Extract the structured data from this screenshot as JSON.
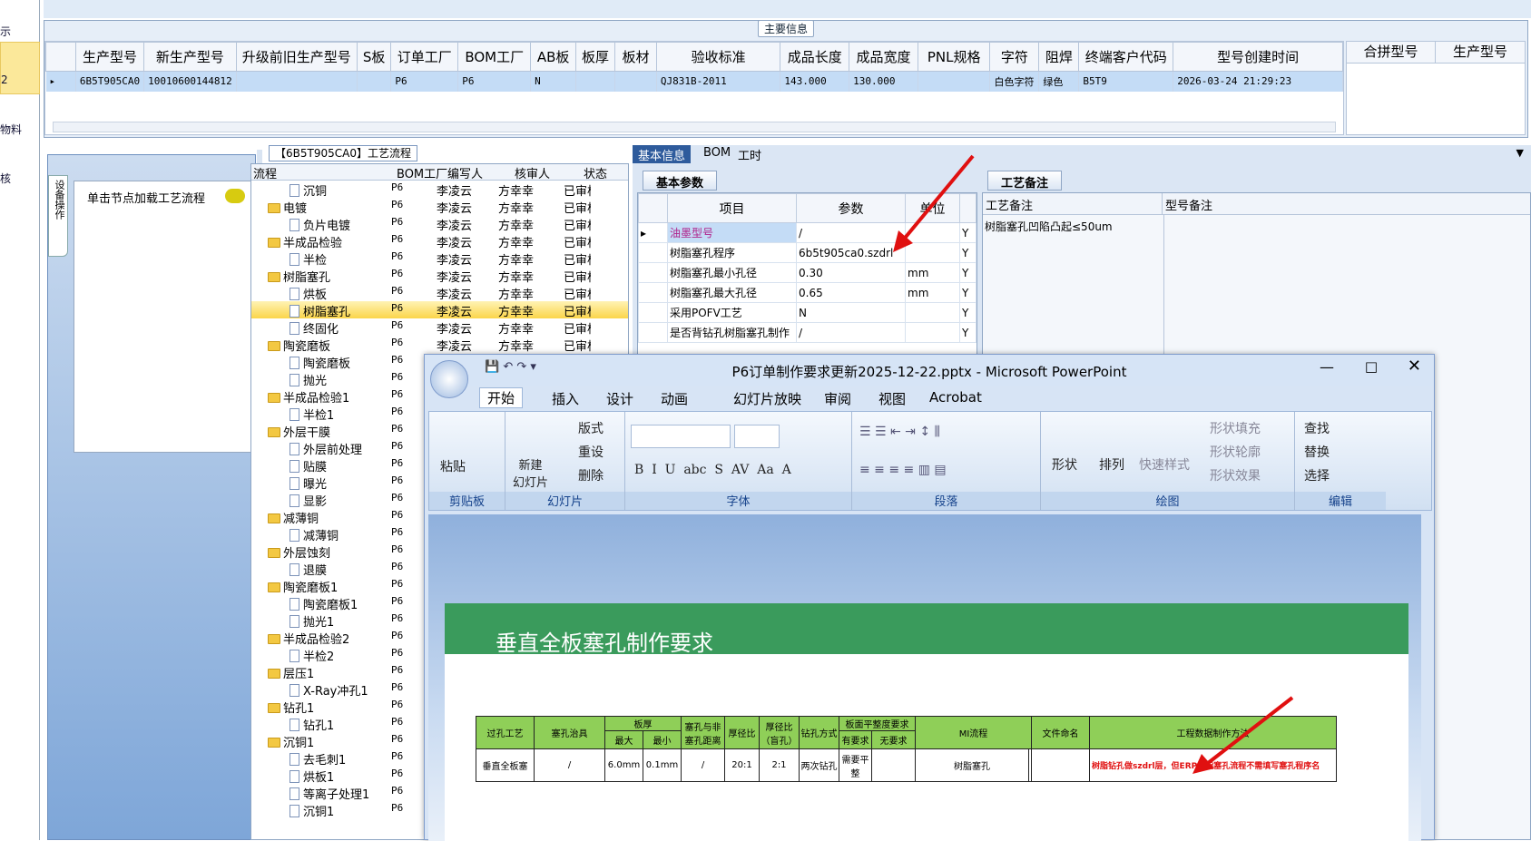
{
  "left_panel": {
    "items": [
      "示",
      "2",
      "物料",
      "核"
    ]
  },
  "main_info": {
    "group_title": "主要信息",
    "columns": [
      "生产型号",
      "新生产型号",
      "升级前旧生产型号",
      "S板",
      "订单工厂",
      "BOM工厂",
      "AB板",
      "板厚",
      "板材",
      "验收标准",
      "成品长度",
      "成品宽度",
      "PNL规格",
      "字符",
      "阻焊",
      "终端客户代码",
      "型号创建时间"
    ],
    "row": [
      "6B5T905CA0",
      "10010600144812",
      "",
      "",
      "P6",
      "P6",
      "N",
      "",
      "",
      "QJ831B-2011",
      "143.000",
      "130.000",
      "",
      "白色字符",
      "绿色",
      "B5T9",
      "2026-03-24 21:29:23"
    ],
    "right_columns": [
      "合拼型号",
      "生产型号"
    ]
  },
  "sidebar": {
    "vtab": "设备操作",
    "hint": "单击节点加载工艺流程"
  },
  "flow": {
    "title": "【6B5T905CA0】工艺流程",
    "columns": [
      "流程",
      "BOM工厂",
      "编写人",
      "核审人",
      "状态"
    ],
    "rows": [
      {
        "n": "沉铜",
        "t": "d",
        "f": "P6",
        "w": "李凌云",
        "r": "方幸幸",
        "s": "已审核"
      },
      {
        "n": "电镀",
        "t": "f",
        "f": "P6",
        "w": "李凌云",
        "r": "方幸幸",
        "s": "已审核"
      },
      {
        "n": "负片电镀",
        "t": "d",
        "f": "P6",
        "w": "李凌云",
        "r": "方幸幸",
        "s": "已审核"
      },
      {
        "n": "半成品检验",
        "t": "f",
        "f": "P6",
        "w": "李凌云",
        "r": "方幸幸",
        "s": "已审核"
      },
      {
        "n": "半检",
        "t": "d",
        "f": "P6",
        "w": "李凌云",
        "r": "方幸幸",
        "s": "已审核"
      },
      {
        "n": "树脂塞孔",
        "t": "f",
        "f": "P6",
        "w": "李凌云",
        "r": "方幸幸",
        "s": "已审核"
      },
      {
        "n": "烘板",
        "t": "d",
        "f": "P6",
        "w": "李凌云",
        "r": "方幸幸",
        "s": "已审核"
      },
      {
        "n": "树脂塞孔",
        "t": "d",
        "f": "P6",
        "w": "李凌云",
        "r": "方幸幸",
        "s": "已审核",
        "hl": true
      },
      {
        "n": "终固化",
        "t": "d",
        "f": "P6",
        "w": "李凌云",
        "r": "方幸幸",
        "s": "已审核"
      },
      {
        "n": "陶瓷磨板",
        "t": "f",
        "f": "P6",
        "w": "李凌云",
        "r": "方幸幸",
        "s": "已审核"
      },
      {
        "n": "陶瓷磨板",
        "t": "d",
        "f": "P6"
      },
      {
        "n": "抛光",
        "t": "d",
        "f": "P6"
      },
      {
        "n": "半成品检验1",
        "t": "f",
        "f": "P6"
      },
      {
        "n": "半检1",
        "t": "d",
        "f": "P6"
      },
      {
        "n": "外层干膜",
        "t": "f",
        "f": "P6"
      },
      {
        "n": "外层前处理",
        "t": "d",
        "f": "P6"
      },
      {
        "n": "贴膜",
        "t": "d",
        "f": "P6"
      },
      {
        "n": "曝光",
        "t": "d",
        "f": "P6"
      },
      {
        "n": "显影",
        "t": "d",
        "f": "P6"
      },
      {
        "n": "减薄铜",
        "t": "f",
        "f": "P6"
      },
      {
        "n": "减薄铜",
        "t": "d",
        "f": "P6"
      },
      {
        "n": "外层蚀刻",
        "t": "f",
        "f": "P6"
      },
      {
        "n": "退膜",
        "t": "d",
        "f": "P6"
      },
      {
        "n": "陶瓷磨板1",
        "t": "f",
        "f": "P6"
      },
      {
        "n": "陶瓷磨板1",
        "t": "d",
        "f": "P6"
      },
      {
        "n": "抛光1",
        "t": "d",
        "f": "P6"
      },
      {
        "n": "半成品检验2",
        "t": "f",
        "f": "P6"
      },
      {
        "n": "半检2",
        "t": "d",
        "f": "P6"
      },
      {
        "n": "层压1",
        "t": "f",
        "f": "P6"
      },
      {
        "n": "X-Ray冲孔1",
        "t": "d",
        "f": "P6"
      },
      {
        "n": "钻孔1",
        "t": "f",
        "f": "P6"
      },
      {
        "n": "钻孔1",
        "t": "d",
        "f": "P6"
      },
      {
        "n": "沉铜1",
        "t": "f",
        "f": "P6"
      },
      {
        "n": "去毛刺1",
        "t": "d",
        "f": "P6"
      },
      {
        "n": "烘板1",
        "t": "d",
        "f": "P6"
      },
      {
        "n": "等离子处理1",
        "t": "d",
        "f": "P6"
      },
      {
        "n": "沉铜1",
        "t": "d",
        "f": "P6"
      }
    ]
  },
  "right": {
    "tabs": [
      "基本信息",
      "BOM",
      "工时"
    ],
    "params_tab": "基本参数",
    "params_cols": [
      "项目",
      "参数",
      "单位"
    ],
    "params": [
      {
        "k": "油墨型号",
        "v": "/",
        "u": "",
        "y": "Y"
      },
      {
        "k": "树脂塞孔程序",
        "v": "6b5t905ca0.szdrl",
        "u": "",
        "y": "Y"
      },
      {
        "k": "树脂塞孔最小孔径",
        "v": "0.30",
        "u": "mm",
        "y": "Y"
      },
      {
        "k": "树脂塞孔最大孔径",
        "v": "0.65",
        "u": "mm",
        "y": "Y"
      },
      {
        "k": "采用POFV工艺",
        "v": "N",
        "u": "",
        "y": "Y"
      },
      {
        "k": "是否背钻孔树脂塞孔制作",
        "v": "/",
        "u": "",
        "y": "Y"
      }
    ],
    "notes_tab": "工艺备注",
    "notes_cols": [
      "工艺备注",
      "型号备注"
    ],
    "note_text": "树脂塞孔凹陷凸起≤50um"
  },
  "ppt": {
    "title": "P6订单制作要求更新2025-12-22.pptx - Microsoft PowerPoint",
    "menus": [
      "开始",
      "插入",
      "设计",
      "动画",
      "幻灯片放映",
      "审阅",
      "视图",
      "Acrobat"
    ],
    "groups": [
      "剪贴板",
      "幻灯片",
      "字体",
      "段落",
      "绘图",
      "编辑"
    ],
    "buttons": {
      "paste": "粘贴",
      "new_slide": "新建\n幻灯片",
      "layout": "版式",
      "reset": "重设",
      "delete": "删除",
      "shape": "形状",
      "arrange": "排列",
      "quick_style": "快速样式",
      "fill": "形状填充",
      "outline": "形状轮廓",
      "effect": "形状效果",
      "find": "查找",
      "replace": "替换",
      "select": "选择"
    },
    "slide_title": "垂直全板塞孔制作要求",
    "table": {
      "h1": [
        "过孔工艺",
        "塞孔治具",
        "板厚",
        "塞孔与非塞孔距离",
        "厚径比",
        "厚径比（盲孔）",
        "钻孔方式",
        "板面平整度要求",
        "MI流程",
        "文件命名",
        "工程数据制作方法"
      ],
      "h2": [
        "最大",
        "最小",
        "有要求",
        "无要求"
      ],
      "row": [
        "垂直全板塞",
        "/",
        "6.0mm",
        "0.1mm",
        "/",
        "20:1",
        "2:1",
        "两次钻孔",
        "需要平整",
        "",
        "树脂塞孔",
        "",
        "",
        ""
      ],
      "red_note": "树脂钻孔做szdrl层，但ERP树脂塞孔流程不需填写塞孔程序名"
    }
  }
}
